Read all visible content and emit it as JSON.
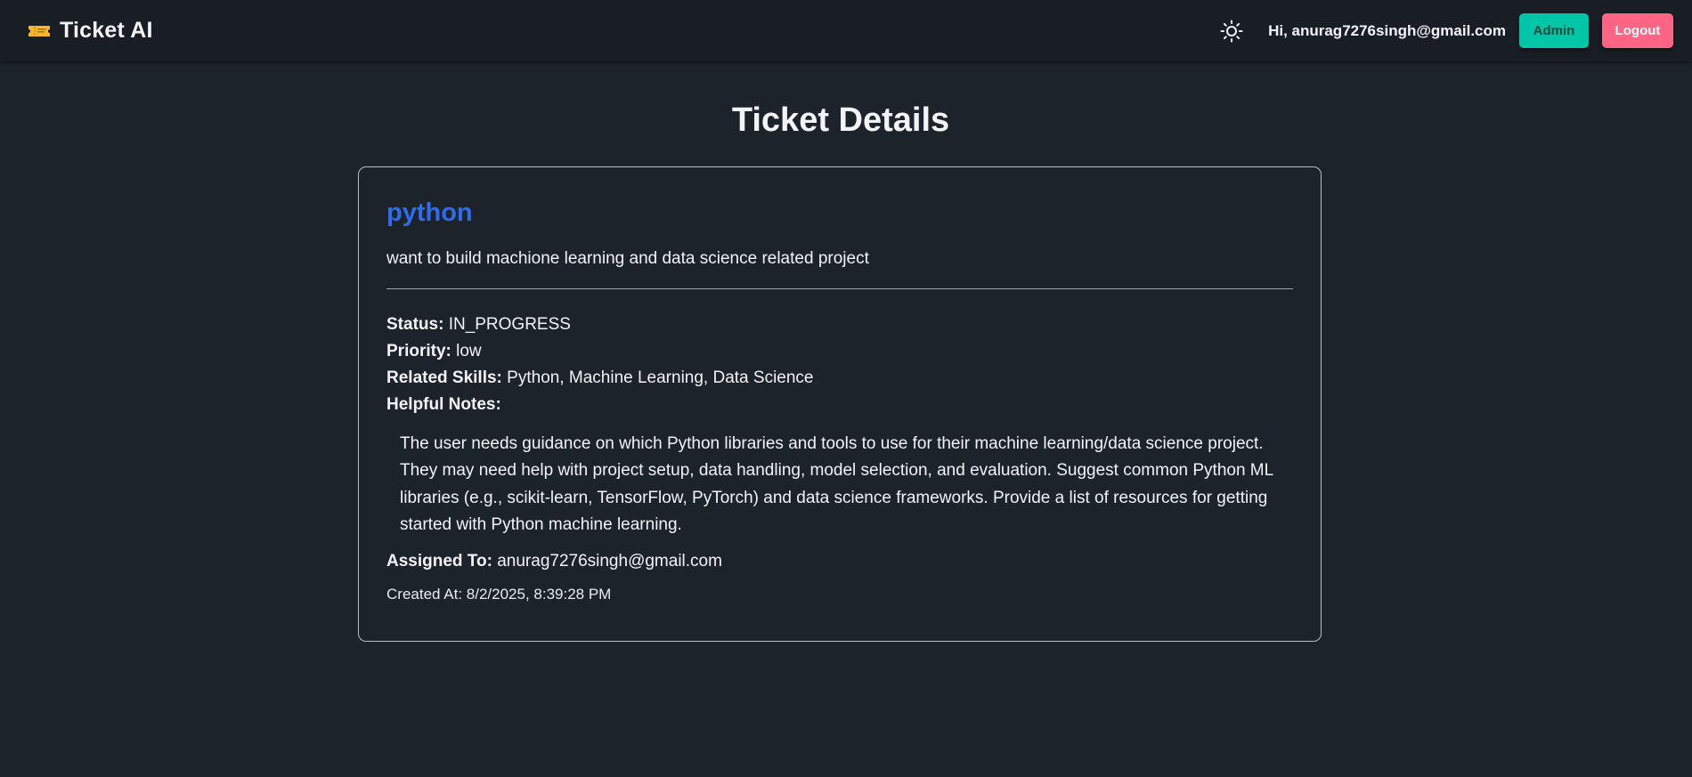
{
  "app": {
    "brand_icon": "ticket-icon",
    "title": "Ticket AI"
  },
  "nav": {
    "theme_icon": "sun-icon",
    "greeting_prefix": "Hi, ",
    "user_email": "anurag7276singh@gmail.com",
    "admin_label": "Admin",
    "logout_label": "Logout"
  },
  "page": {
    "title": "Ticket Details"
  },
  "ticket": {
    "title": "python",
    "description": "want to build machione learning and data science related project",
    "status_label": "Status:",
    "status": "IN_PROGRESS",
    "priority_label": "Priority:",
    "priority": "low",
    "skills_label": "Related Skills:",
    "skills": "Python, Machine Learning, Data Science",
    "notes_label": "Helpful Notes:",
    "notes": "The user needs guidance on which Python libraries and tools to use for their machine learning/data science project. They may need help with project setup, data handling, model selection, and evaluation. Suggest common Python ML libraries (e.g., scikit-learn, TensorFlow, PyTorch) and data science frameworks. Provide a list of resources for getting started with Python machine learning.",
    "assigned_label": "Assigned To:",
    "assigned_to": "anurag7276singh@gmail.com",
    "created_at": "Created At: 8/2/2025, 8:39:28 PM"
  },
  "colors": {
    "background": "#1d232a",
    "navbar": "#191e24",
    "ticket_title": "#2f6bf0",
    "admin_button": "#00c6a7",
    "logout_button": "#ff6484"
  }
}
